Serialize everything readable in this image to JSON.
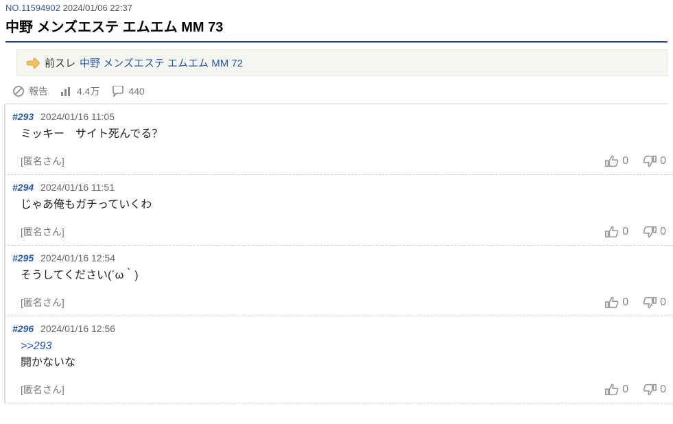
{
  "header": {
    "thread_no_label": "NO.11594902",
    "thread_date": "2024/01/06 22:37",
    "title": "中野 メンズエステ エムエム MM 73",
    "prev_thread": {
      "prefix": "前スレ",
      "link_text": "中野 メンズエステ エムエム MM 72"
    }
  },
  "stats": {
    "report_label": "報告",
    "views": "4.4万",
    "comments": "440"
  },
  "replies": [
    {
      "num": "#293",
      "date": "2024/01/16 11:05",
      "body": "ミッキー　サイト死んでる？",
      "reflink": "",
      "author": "[匿名さん]",
      "up": "0",
      "down": "0"
    },
    {
      "num": "#294",
      "date": "2024/01/16 11:51",
      "body": "じゃあ俺もガチっていくわ",
      "reflink": "",
      "author": "[匿名さん]",
      "up": "0",
      "down": "0"
    },
    {
      "num": "#295",
      "date": "2024/01/16 12:54",
      "body": "そうしてください(´ω｀)",
      "reflink": "",
      "author": "[匿名さん]",
      "up": "0",
      "down": "0"
    },
    {
      "num": "#296",
      "date": "2024/01/16 12:56",
      "body": "開かないな",
      "reflink": ">>293",
      "author": "[匿名さん]",
      "up": "0",
      "down": "0"
    }
  ]
}
